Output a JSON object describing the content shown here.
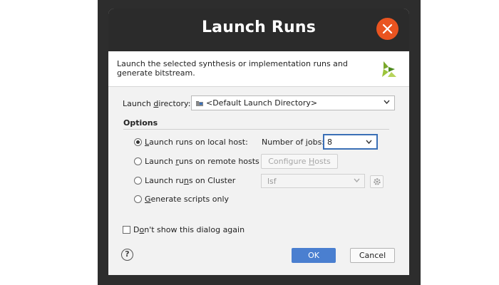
{
  "dialog": {
    "title": "Launch Runs",
    "description": "Launch the selected synthesis or implementation runs and generate bitstream."
  },
  "launch_directory": {
    "label_pre": "Launch ",
    "label_mnemonic": "d",
    "label_post": "irectory:",
    "value": "<Default Launch Directory>"
  },
  "options": {
    "title": "Options",
    "local": {
      "pre": "",
      "mn": "L",
      "post": "aunch runs on local host:",
      "selected": true
    },
    "jobs": {
      "label_pre": "Number of ",
      "label_mn": "j",
      "label_post": "obs:",
      "value": "8"
    },
    "remote": {
      "pre": "Launch ",
      "mn": "r",
      "post": "uns on remote hosts",
      "selected": false
    },
    "configure_hosts": {
      "pre": "Configure ",
      "mn": "H",
      "post": "osts"
    },
    "cluster": {
      "pre": "Launch ru",
      "mn": "n",
      "post": "s on Cluster",
      "selected": false
    },
    "cluster_value": "lsf",
    "scripts": {
      "pre": "",
      "mn": "G",
      "post": "enerate scripts only",
      "selected": false
    }
  },
  "dont_show": {
    "pre": "D",
    "mn": "o",
    "post": "n't show this dialog again",
    "checked": false
  },
  "buttons": {
    "ok": "OK",
    "cancel": "Cancel",
    "help": "?"
  },
  "colors": {
    "title_bar": "#2b2b2b",
    "close": "#e95420",
    "primary": "#4a7fd0"
  },
  "icons": [
    "close-icon",
    "xilinx-logo",
    "folder-icon",
    "chevron-down-icon",
    "gear-icon",
    "help-icon"
  ]
}
